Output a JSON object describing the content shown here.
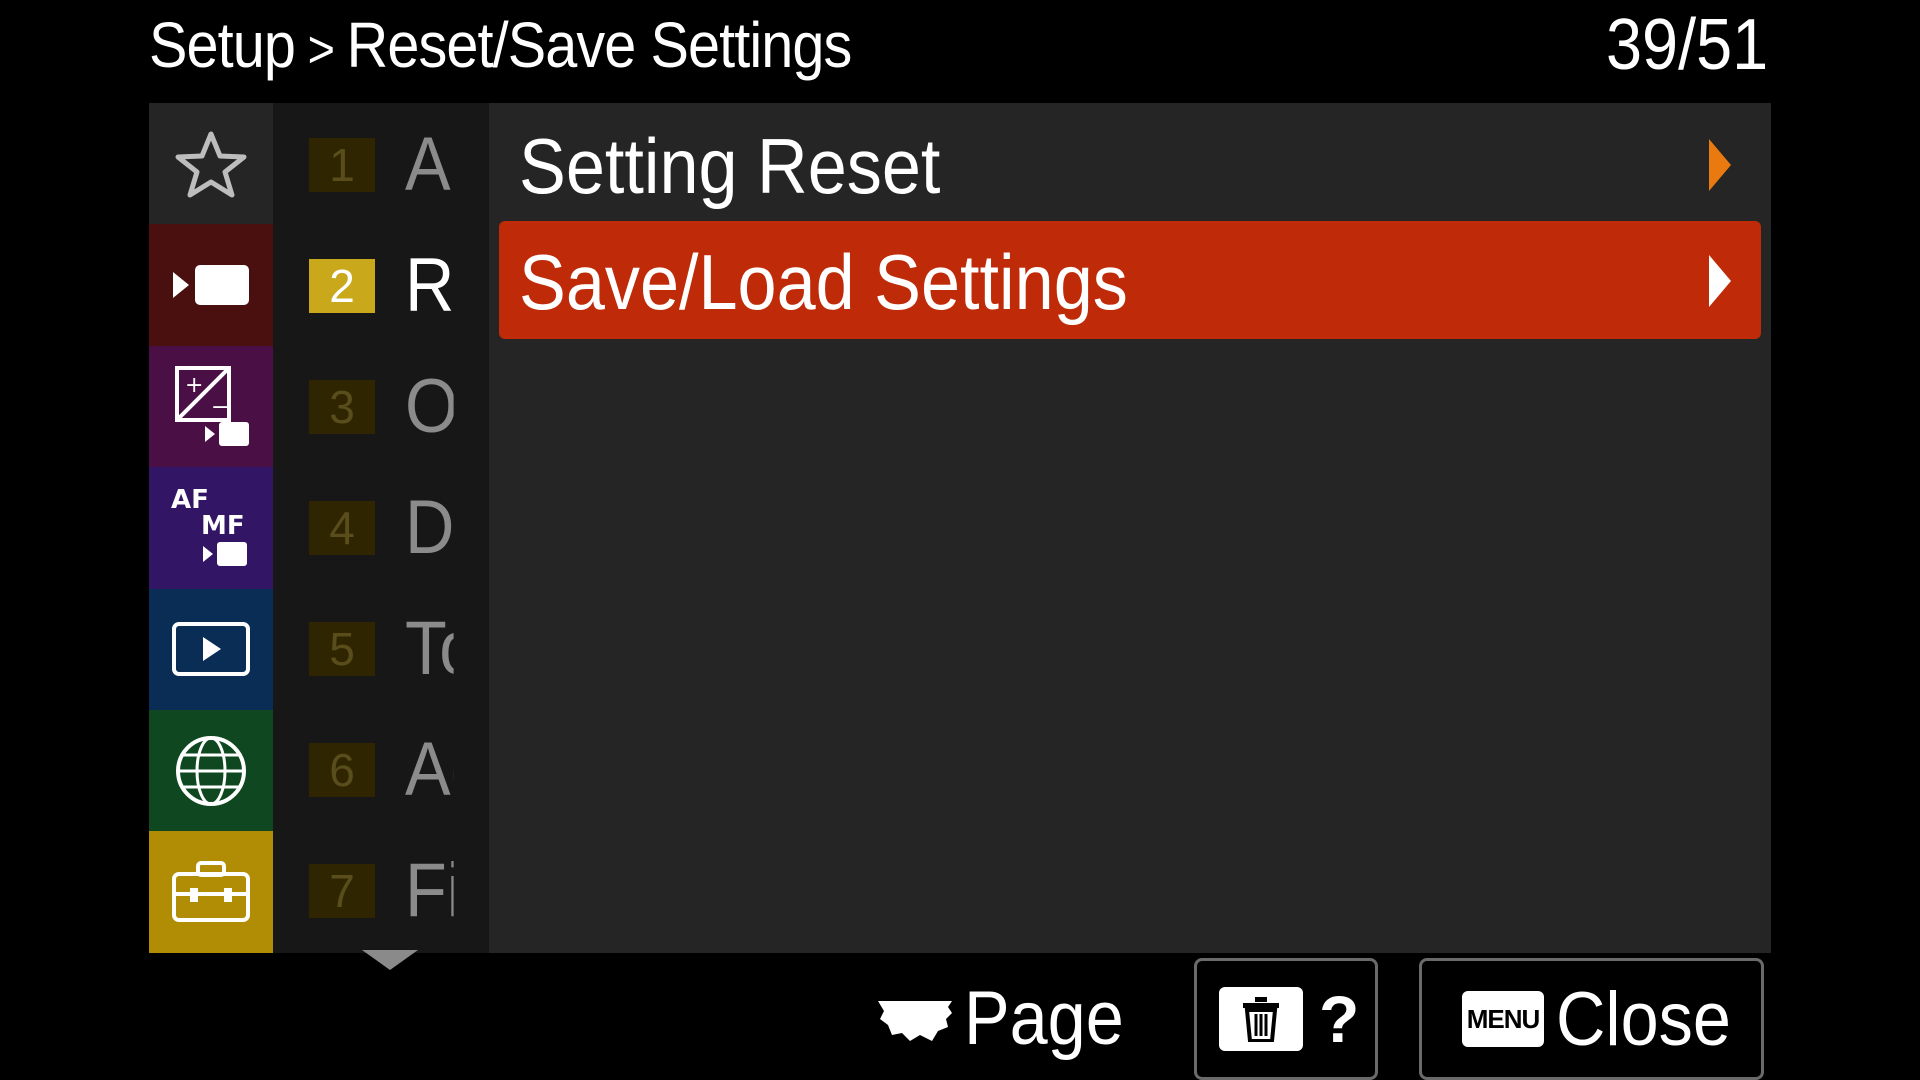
{
  "header": {
    "breadcrumb_root": "Setup",
    "breadcrumb_separator": ">",
    "breadcrumb_current": "Reset/Save Settings",
    "page_indicator": "39/51"
  },
  "tabs": [
    {
      "name": "favorites",
      "icon": "star-icon",
      "color": "#252525"
    },
    {
      "name": "shooting",
      "icon": "movie-camera-icon",
      "color": "#4a1010"
    },
    {
      "name": "exposure-color",
      "icon": "exposure-compensation-icon",
      "color": "#4a1045"
    },
    {
      "name": "focus",
      "icon": "af-mf-icon",
      "color": "#331565"
    },
    {
      "name": "playback",
      "icon": "playback-icon",
      "color": "#0a2d55"
    },
    {
      "name": "network",
      "icon": "globe-icon",
      "color": "#0f4820"
    },
    {
      "name": "setup",
      "icon": "toolbox-icon",
      "color": "#b18d05",
      "active": true
    }
  ],
  "sublist": [
    {
      "number": "1",
      "label": "Ar"
    },
    {
      "number": "2",
      "label": "Re",
      "active": true
    },
    {
      "number": "3",
      "label": "Op"
    },
    {
      "number": "4",
      "label": "Di"
    },
    {
      "number": "5",
      "label": "To"
    },
    {
      "number": "6",
      "label": "Ac"
    },
    {
      "number": "7",
      "label": "Fi"
    }
  ],
  "menu_items": [
    {
      "label": "Setting Reset",
      "arrow_color": "#e87a10",
      "selected": false
    },
    {
      "label": "Save/Load Settings",
      "arrow_color": "#ffffff",
      "selected": true
    }
  ],
  "footer": {
    "page_label": "Page",
    "help_label": "?",
    "menu_key": "MENU",
    "close_label": "Close"
  },
  "colors": {
    "selected_bg": "#bf2b08",
    "panel_bg": "#252525",
    "active_number_bg": "#c9a91b"
  }
}
